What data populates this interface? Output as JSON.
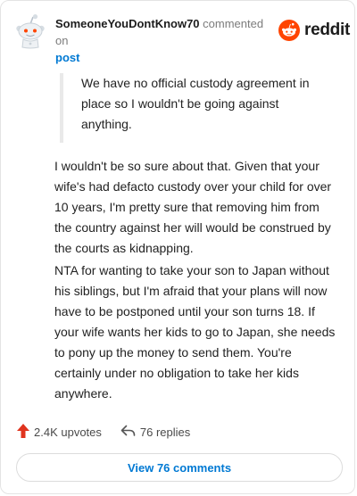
{
  "header": {
    "username": "SomeoneYouDontKnow70",
    "action_text": "commented on",
    "post_link_label": "post",
    "brand_wordmark": "reddit",
    "brand_icon": "reddit-snoo-icon",
    "avatar_icon": "snoo-avatar-icon"
  },
  "comment": {
    "quote": "We have no official custody agreement in place so I wouldn't be going against anything.",
    "paragraphs": [
      "I wouldn't be so sure about that. Given that your wife's had defacto custody over your child for over 10 years, I'm pretty sure that removing him from the country against her will would be construed by the courts as kidnapping.",
      "NTA for wanting to take your son to Japan without his siblings, but I'm afraid that your plans will now have to be postponed until your son turns 18. If your wife wants her kids to go to Japan, she needs to pony up the money to send them. You're certainly under no obligation to take her kids anywhere."
    ]
  },
  "footer": {
    "upvotes_label": "2.4K upvotes",
    "upvote_icon": "upvote-arrow-icon",
    "replies_label": "76 replies",
    "reply_icon": "reply-arrow-icon",
    "view_comments_label": "View 76 comments"
  },
  "colors": {
    "link_blue": "#0079d3",
    "reddit_orange": "#ff4500",
    "upvote_red": "#e0341e",
    "border": "#e4e4e4",
    "quote_bar": "#e9e9e9"
  }
}
